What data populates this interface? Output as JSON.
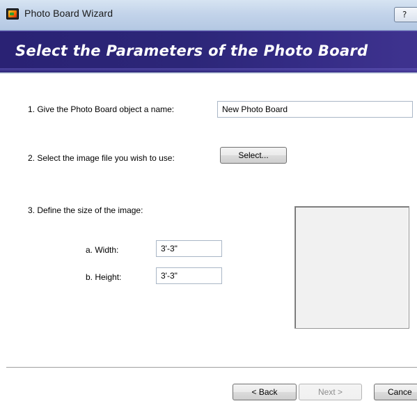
{
  "window": {
    "title": "Photo Board Wizard",
    "help_label": "?"
  },
  "banner": {
    "title": "Select the Parameters of the Photo Board"
  },
  "form": {
    "name_label": "1. Give the Photo Board object a name:",
    "name_value": "New Photo Board",
    "file_label": "2. Select the image file you wish to use:",
    "select_button": "Select...",
    "size_label": "3. Define the size of the image:",
    "width_label": "a. Width:",
    "width_value": "3'-3\"",
    "height_label": "b. Height:",
    "height_value": "3'-3\""
  },
  "footer": {
    "back_button": "< Back",
    "next_button": "Next >",
    "cancel_button": "Cance"
  },
  "colors": {
    "banner_bg": "#2c2678",
    "titlebar_bg": "#c3d4ea"
  },
  "icons": {
    "app_icon": "photo-board-icon",
    "help_icon": "question-icon"
  }
}
